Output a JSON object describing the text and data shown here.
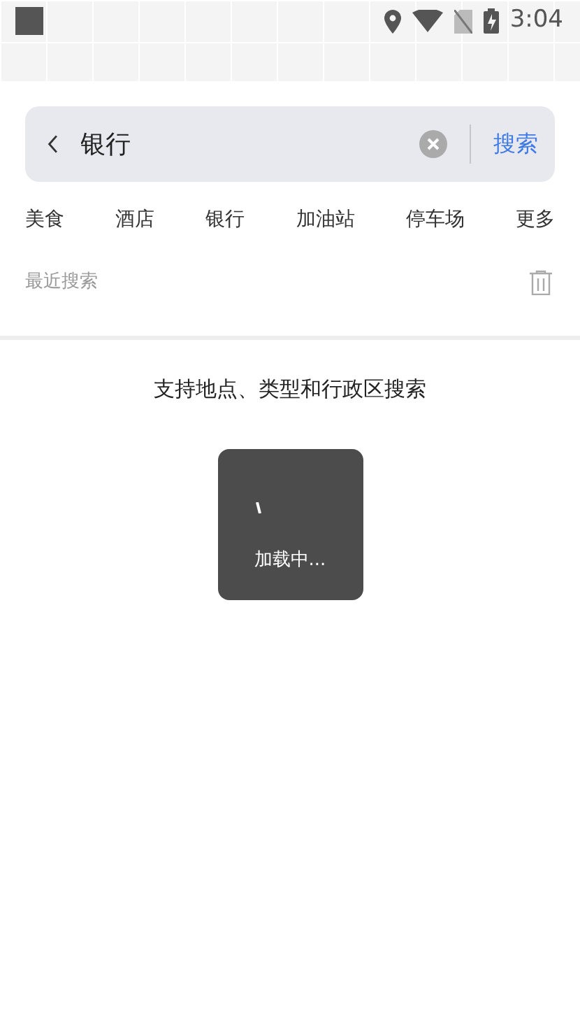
{
  "status_bar": {
    "time": "3:04"
  },
  "search": {
    "value": "银行",
    "action": "搜索"
  },
  "categories": [
    "美食",
    "酒店",
    "银行",
    "加油站",
    "停车场",
    "更多"
  ],
  "recent": {
    "title": "最近搜索"
  },
  "hint": "支持地点、类型和行政区搜索",
  "loading": {
    "text": "加载中..."
  }
}
